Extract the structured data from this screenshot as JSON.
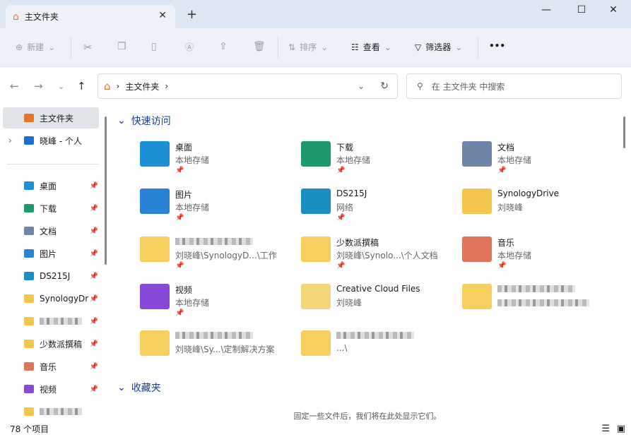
{
  "window": {
    "tab_title": "主文件夹",
    "new_tab": "+",
    "minimize": "—",
    "maximize": "☐",
    "close": "✕"
  },
  "toolbar": {
    "new": "新建",
    "sort": "排序",
    "view": "查看",
    "filter": "筛选器",
    "more": "•••"
  },
  "address": {
    "crumb": "主文件夹",
    "sep": "›",
    "search_placeholder": "在 主文件夹 中搜索"
  },
  "sidebar": {
    "items": [
      {
        "label": "主文件夹",
        "color": "#e8742a",
        "selected": true,
        "pin": false
      },
      {
        "label": "晓峰 - 个人",
        "color": "#1f6fd1",
        "pin": false,
        "expand": true
      },
      {
        "label": "桌面",
        "color": "#1e90d6",
        "pin": true
      },
      {
        "label": "下载",
        "color": "#1d9a6c",
        "pin": true
      },
      {
        "label": "文档",
        "color": "#6f86a8",
        "pin": true
      },
      {
        "label": "图片",
        "color": "#2b83d6",
        "pin": true
      },
      {
        "label": "DS215J",
        "color": "#1b8fc1",
        "pin": true
      },
      {
        "label": "SynologyDr",
        "color": "#f4c64f",
        "pin": true
      },
      {
        "label": "",
        "color": "#f4c64f",
        "pin": true,
        "blur": true
      },
      {
        "label": "少数派撰稿",
        "color": "#f4c64f",
        "pin": true
      },
      {
        "label": "音乐",
        "color": "#e0735a",
        "pin": true
      },
      {
        "label": "视频",
        "color": "#8a49d6",
        "pin": true
      },
      {
        "label": "",
        "color": "#f4c64f",
        "pin": false,
        "blur": true
      }
    ]
  },
  "quick_access": {
    "title": "快速访问",
    "items": [
      {
        "name": "桌面",
        "sub": "本地存储",
        "color": "#1e90d6",
        "pinned": true
      },
      {
        "name": "下载",
        "sub": "本地存储",
        "color": "#1d9a6c",
        "pinned": true
      },
      {
        "name": "文档",
        "sub": "本地存储",
        "color": "#6f86a8",
        "pinned": true
      },
      {
        "name": "图片",
        "sub": "本地存储",
        "color": "#2b83d6",
        "pinned": true
      },
      {
        "name": "DS215J",
        "sub": "网络",
        "color": "#1b8fc1",
        "pinned": true
      },
      {
        "name": "SynologyDrive",
        "sub": "刘晓峰",
        "color": "#f4c64f",
        "pinned": false
      },
      {
        "name": "",
        "sub": "刘晓峰\\SynologyD...\\工作",
        "color": "#f7cf5e",
        "pinned": true,
        "blur": true
      },
      {
        "name": "少数派撰稿",
        "sub": "刘晓峰\\Synolo...\\个人文档",
        "color": "#f7cf5e",
        "pinned": true
      },
      {
        "name": "音乐",
        "sub": "本地存储",
        "color": "#e0735a",
        "pinned": true
      },
      {
        "name": "视频",
        "sub": "本地存储",
        "color": "#8a49d6",
        "pinned": true
      },
      {
        "name": "Creative Cloud Files",
        "sub": "刘晓峰",
        "color": "#f4d77a",
        "pinned": false
      },
      {
        "name": "",
        "sub": "",
        "color": "#f7cf5e",
        "pinned": false,
        "blur": true
      },
      {
        "name": "",
        "sub": "刘晓峰\\Sy...\\定制解决方案",
        "color": "#f7cf5e",
        "pinned": false,
        "blur": true
      },
      {
        "name": "",
        "sub": "...\\",
        "color": "#f7cf5e",
        "pinned": false,
        "blur": true
      }
    ]
  },
  "favorites": {
    "title": "收藏夹",
    "empty": "固定一些文件后，我们将在此处显示它们。"
  },
  "status": {
    "count": "78 个项目"
  }
}
